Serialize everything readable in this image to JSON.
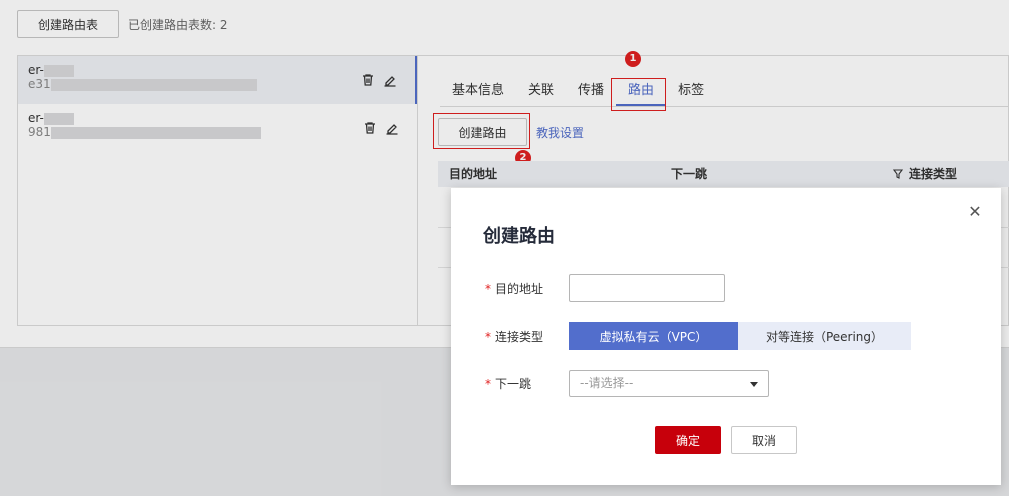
{
  "toolbar": {
    "create_route_table_label": "创建路由表",
    "count_text": "已创建路由表数: 2"
  },
  "route_tables": [
    {
      "name": "er-",
      "id": "e31"
    },
    {
      "name": "er-",
      "id": "981"
    }
  ],
  "tabs": [
    "基本信息",
    "关联",
    "传播",
    "路由",
    "标签"
  ],
  "active_tab": "路由",
  "route_panel": {
    "create_route_label": "创建路由",
    "help_link": "教我设置",
    "columns": [
      "目的地址",
      "下一跳",
      "连接类型"
    ]
  },
  "annotations": [
    "1",
    "2"
  ],
  "modal": {
    "title": "创建路由",
    "required_mark": "*",
    "dest_label": "目的地址",
    "dest_value": "",
    "conn_type_label": "连接类型",
    "conn_type_options": [
      "虚拟私有云（VPC）",
      "对等连接（Peering）"
    ],
    "conn_type_selected": "虚拟私有云（VPC）",
    "next_hop_label": "下一跳",
    "next_hop_placeholder": "--请选择--",
    "ok_label": "确定",
    "cancel_label": "取消"
  },
  "icons": {
    "delete": "trash-icon",
    "edit": "pencil-icon",
    "filter": "filter-icon",
    "close": "close-icon"
  },
  "colors": {
    "accent": "#526ecc",
    "danger": "#c7000b",
    "annotation": "#e02020"
  }
}
